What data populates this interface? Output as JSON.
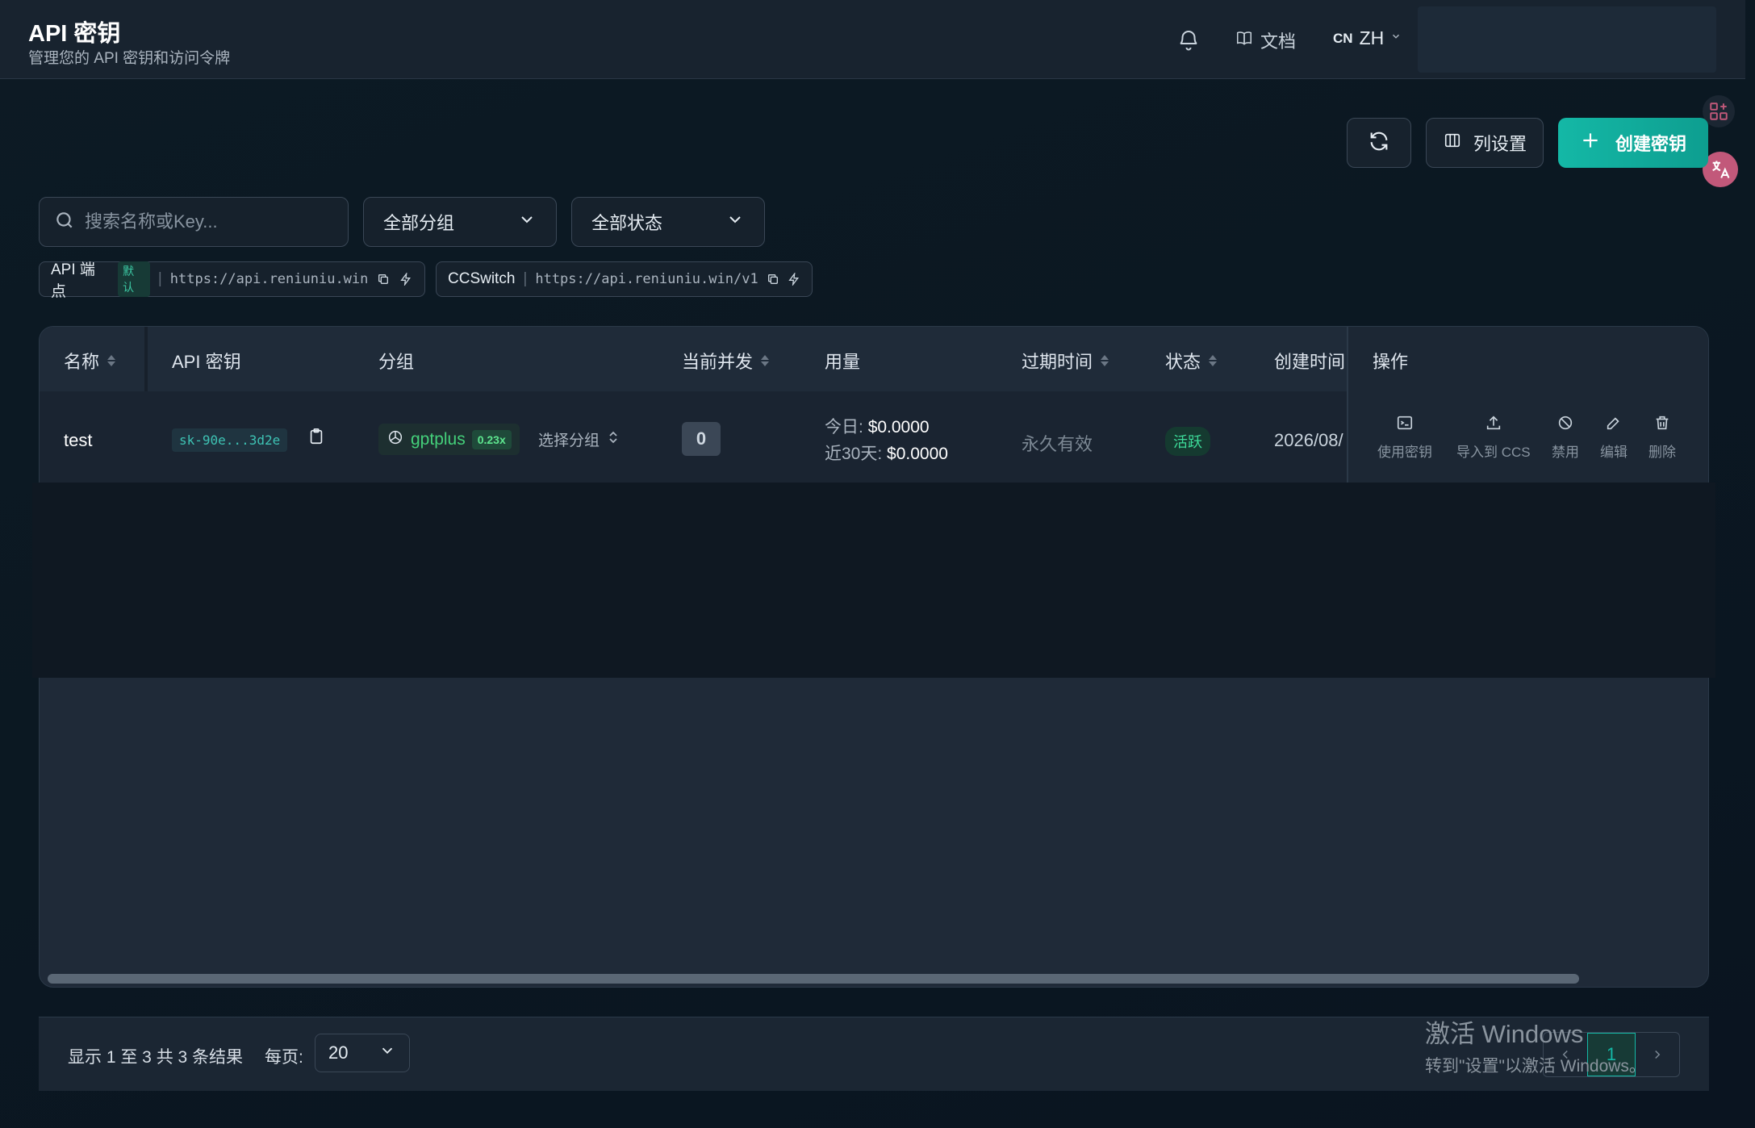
{
  "header": {
    "title": "API 密钥",
    "subtitle": "管理您的 API 密钥和访问令牌",
    "docs_label": "文档",
    "lang_code": "CN",
    "lang_label": "ZH"
  },
  "toolbar": {
    "columns_label": "列设置",
    "create_label": "创建密钥"
  },
  "filters": {
    "search_placeholder": "搜索名称或Key...",
    "group_select": "全部分组",
    "status_select": "全部状态"
  },
  "endpoints": [
    {
      "name": "API 端点",
      "badge": "默认",
      "url": "https://api.reniuniu.win"
    },
    {
      "name": "CCSwitch",
      "url": "https://api.reniuniu.win/v1"
    }
  ],
  "table": {
    "columns": [
      "名称",
      "API 密钥",
      "分组",
      "当前并发",
      "用量",
      "过期时间",
      "状态",
      "创建时间",
      "操作"
    ],
    "rows": [
      {
        "name": "test",
        "key": "sk-90e...3d2e",
        "group": "gptplus",
        "ratio": "0.23x",
        "choose_group": "选择分组",
        "concurrency": "0",
        "usage_today_label": "今日:",
        "usage_today": "$0.0000",
        "usage_30d_label": "近30天:",
        "usage_30d": "$0.0000",
        "expire": "永久有效",
        "status": "活跃",
        "created": "2026/08/",
        "actions": [
          "使用密钥",
          "导入到 CCS",
          "禁用",
          "编辑",
          "删除"
        ]
      }
    ]
  },
  "pagination": {
    "info": "显示 1 至 3 共 3 条结果",
    "per_page_label": "每页:",
    "per_page_value": "20",
    "current_page": "1"
  },
  "watermark": {
    "line1": "激活 Windows",
    "line2": "转到\"设置\"以激活 Windows。"
  },
  "colors": {
    "accent": "#14b8a6",
    "active_green": "#3ddc9a",
    "background": "#0b1822"
  }
}
